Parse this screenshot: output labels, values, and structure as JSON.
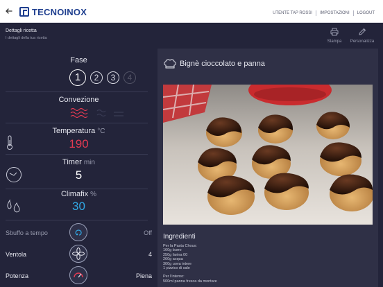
{
  "topbar": {
    "logo": "TECNOINOX",
    "nav": [
      "UTENTE TAP ROSSI",
      "IMPOSTAZIONI",
      "LOGOUT"
    ]
  },
  "header": {
    "title": "Dettagli ricetta",
    "subtitle": "I dettagli della tua ricetta",
    "print_label": "Stampa",
    "customize_label": "Personalizza"
  },
  "left": {
    "fase_label": "Fase",
    "fasi": [
      "1",
      "2",
      "3",
      "4"
    ],
    "mode_label": "Convezione",
    "temperature": {
      "label": "Temperatura",
      "unit": "°C",
      "value": "190",
      "color": "#e23a52"
    },
    "timer": {
      "label": "Timer",
      "unit": "min",
      "value": "5",
      "color": "#ffffff"
    },
    "climafix": {
      "label": "Climafix",
      "unit": "%",
      "value": "30",
      "color": "#31a9e6"
    },
    "rows": [
      {
        "label": "Sbuffo a tempo",
        "value": "Off"
      },
      {
        "label": "Ventola",
        "value": "4"
      },
      {
        "label": "Potenza",
        "value": "Piena"
      }
    ]
  },
  "recipe": {
    "title": "Bignè cioccolato e panna",
    "ingredients_title": "Ingredienti",
    "ingredients": [
      "Per la Pasta Choux:",
      "160g burro",
      "250g farina 00",
      "260g acqua",
      "300g uova intere",
      "1 pizzico di sale",
      "",
      "Per l'interno:",
      "500ml panna fresca da montare"
    ]
  },
  "colors": {
    "accent_blue": "#1f3f8f",
    "temp_red": "#e23a52",
    "climafix_blue": "#31a9e6"
  }
}
